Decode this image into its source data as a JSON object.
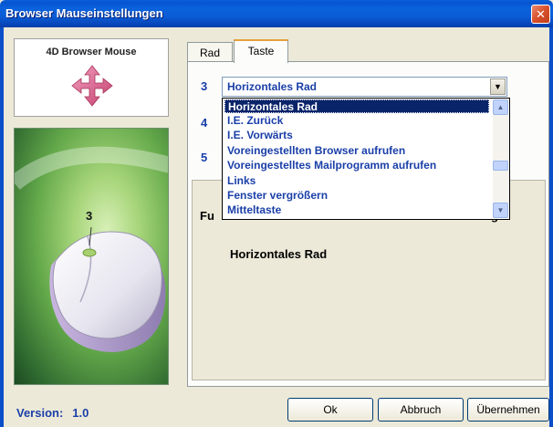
{
  "window": {
    "title": "Browser Mauseinstellungen",
    "close_glyph": "✕"
  },
  "logo": {
    "text": "4D Browser Mouse",
    "icon": "four-arrow-move-icon"
  },
  "illustration": {
    "button_number": "3"
  },
  "version": {
    "label": "Version:",
    "value": "1.0"
  },
  "tabs": [
    {
      "label": "Rad",
      "active": false
    },
    {
      "label": "Taste",
      "active": true
    }
  ],
  "rows": [
    {
      "number": "3"
    },
    {
      "number": "4"
    },
    {
      "number": "5"
    }
  ],
  "combo": {
    "selected": "Horizontales Rad",
    "arrow_glyph": "▼"
  },
  "dropdown": {
    "items": [
      "Horizontales Rad",
      "I.E. Zurück",
      "I.E. Vorwärts",
      "Voreingestellten Browser aufrufen",
      "Voreingestelltes Mailprogramm aufrufen",
      "Links",
      "Fenster vergrößern",
      "Mitteltaste"
    ],
    "selected_index": 0,
    "scroll_up_glyph": "▲",
    "scroll_down_glyph": "▼"
  },
  "group": {
    "label_visible": "Fu",
    "label_tail": "g",
    "function_value": "Horizontales Rad"
  },
  "buttons": {
    "ok": "Ok",
    "cancel": "Abbruch",
    "apply": "Übernehmen"
  }
}
